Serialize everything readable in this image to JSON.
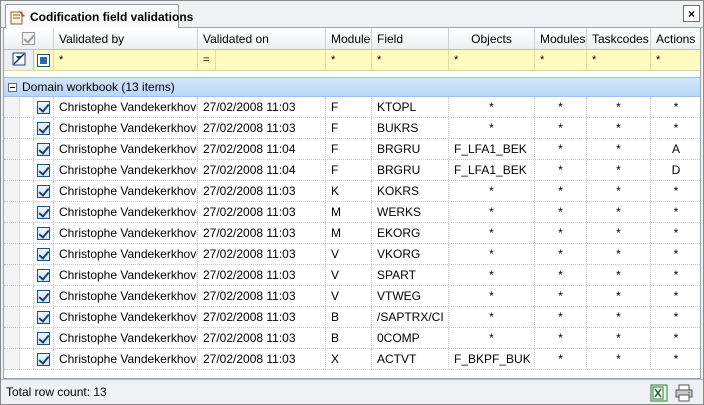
{
  "window": {
    "tab_title": "Codification field validations",
    "close_label": "×"
  },
  "columns": {
    "validated_by": "Validated by",
    "validated_on": "Validated on",
    "module": "Module",
    "field": "Field",
    "objects": "Objects",
    "modules": "Modules",
    "taskcodes": "Taskcodes",
    "actions": "Actions"
  },
  "filters": {
    "validated_by": "*",
    "validated_on": "=",
    "module": "*",
    "field": "*",
    "objects": "*",
    "modules": "*",
    "taskcodes": "*",
    "actions": "*"
  },
  "group": {
    "label": "Domain workbook (13 items)"
  },
  "rows": [
    {
      "checked": true,
      "validated_by": "Christophe Vandekerkhove",
      "validated_on": "27/02/2008 11:03",
      "module": "F",
      "field": "KTOPL",
      "objects": "*",
      "modules": "*",
      "taskcodes": "*",
      "actions": "*"
    },
    {
      "checked": true,
      "validated_by": "Christophe Vandekerkhove",
      "validated_on": "27/02/2008 11:03",
      "module": "F",
      "field": "BUKRS",
      "objects": "*",
      "modules": "*",
      "taskcodes": "*",
      "actions": "*"
    },
    {
      "checked": true,
      "validated_by": "Christophe Vandekerkhove",
      "validated_on": "27/02/2008 11:04",
      "module": "F",
      "field": "BRGRU",
      "objects": "F_LFA1_BEK",
      "modules": "*",
      "taskcodes": "*",
      "actions": "A"
    },
    {
      "checked": true,
      "validated_by": "Christophe Vandekerkhove",
      "validated_on": "27/02/2008 11:04",
      "module": "F",
      "field": "BRGRU",
      "objects": "F_LFA1_BEK",
      "modules": "*",
      "taskcodes": "*",
      "actions": "D"
    },
    {
      "checked": true,
      "validated_by": "Christophe Vandekerkhove",
      "validated_on": "27/02/2008 11:03",
      "module": "K",
      "field": "KOKRS",
      "objects": "*",
      "modules": "*",
      "taskcodes": "*",
      "actions": "*"
    },
    {
      "checked": true,
      "validated_by": "Christophe Vandekerkhove",
      "validated_on": "27/02/2008 11:03",
      "module": "M",
      "field": "WERKS",
      "objects": "*",
      "modules": "*",
      "taskcodes": "*",
      "actions": "*"
    },
    {
      "checked": true,
      "validated_by": "Christophe Vandekerkhove",
      "validated_on": "27/02/2008 11:03",
      "module": "M",
      "field": "EKORG",
      "objects": "*",
      "modules": "*",
      "taskcodes": "*",
      "actions": "*"
    },
    {
      "checked": true,
      "validated_by": "Christophe Vandekerkhove",
      "validated_on": "27/02/2008 11:03",
      "module": "V",
      "field": "VKORG",
      "objects": "*",
      "modules": "*",
      "taskcodes": "*",
      "actions": "*"
    },
    {
      "checked": true,
      "validated_by": "Christophe Vandekerkhove",
      "validated_on": "27/02/2008 11:03",
      "module": "V",
      "field": "SPART",
      "objects": "*",
      "modules": "*",
      "taskcodes": "*",
      "actions": "*"
    },
    {
      "checked": true,
      "validated_by": "Christophe Vandekerkhove",
      "validated_on": "27/02/2008 11:03",
      "module": "V",
      "field": "VTWEG",
      "objects": "*",
      "modules": "*",
      "taskcodes": "*",
      "actions": "*"
    },
    {
      "checked": true,
      "validated_by": "Christophe Vandekerkhove",
      "validated_on": "27/02/2008 11:03",
      "module": "B",
      "field": "/SAPTRX/CI",
      "objects": "*",
      "modules": "*",
      "taskcodes": "*",
      "actions": "*"
    },
    {
      "checked": true,
      "validated_by": "Christophe Vandekerkhove",
      "validated_on": "27/02/2008 11:03",
      "module": "B",
      "field": "0COMP",
      "objects": "*",
      "modules": "*",
      "taskcodes": "*",
      "actions": "*"
    },
    {
      "checked": true,
      "validated_by": "Christophe Vandekerkhove",
      "validated_on": "27/02/2008 11:03",
      "module": "X",
      "field": "ACTVT",
      "objects": "F_BKPF_BUK",
      "modules": "*",
      "taskcodes": "*",
      "actions": "*"
    }
  ],
  "status": {
    "row_count_text": "Total row count: 13"
  },
  "icons": {
    "tab": "form-icon",
    "export": "excel-export-icon",
    "print": "print-icon"
  }
}
